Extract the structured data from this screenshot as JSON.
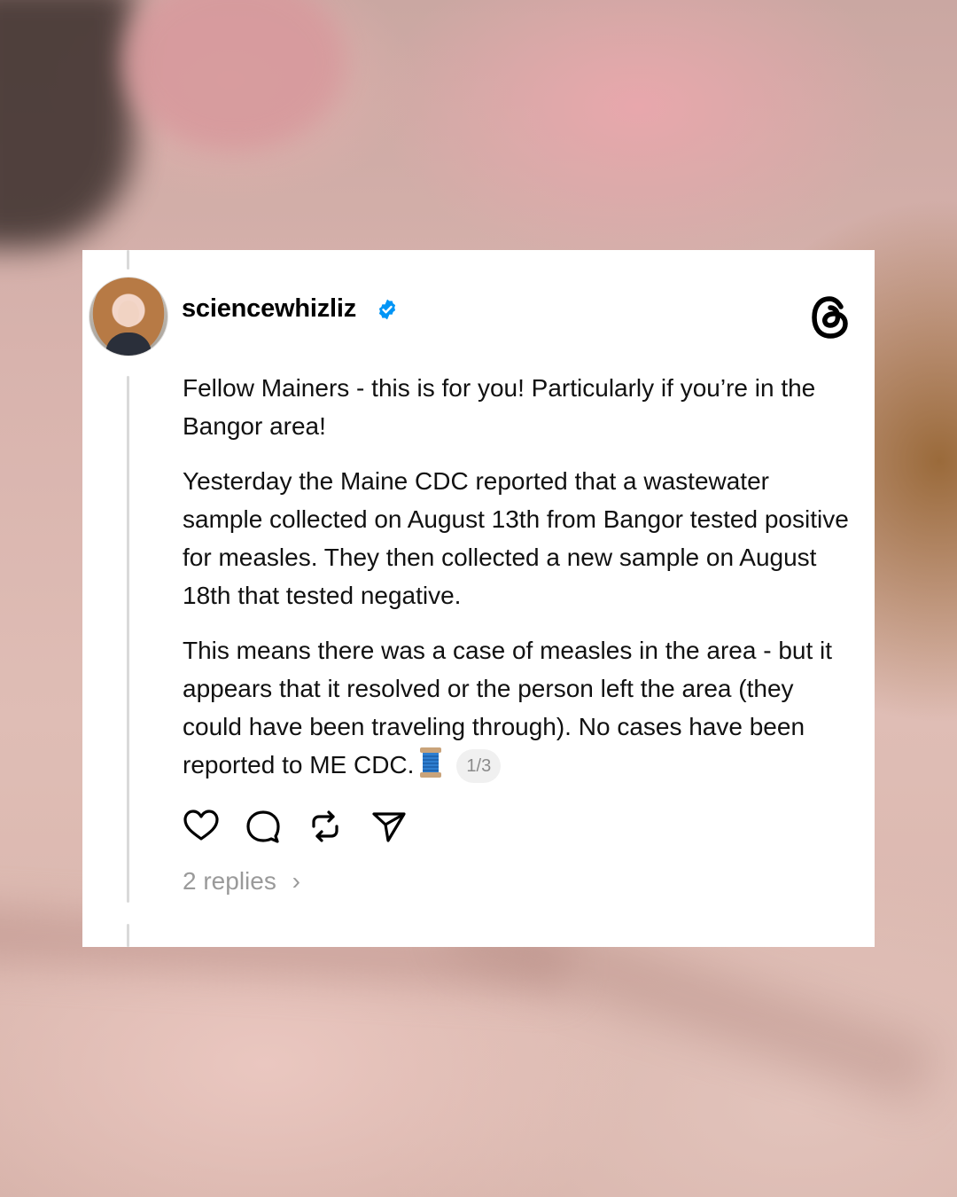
{
  "post": {
    "username": "sciencewhizliz",
    "paragraphs": [
      "Fellow Mainers - this is for you! Particularly if you’re in the Bangor area!",
      "Yesterday the Maine CDC reported that a wastewater sample collected on August 13th from Bangor tested positive for measles. They then collected a new sample on August 18th that tested negative.",
      "This means there was a case of measles in the area - but it appears that it resolved or the person left the area (they could have been traveling through). No cases have been reported to ME CDC."
    ],
    "thread_emoji": "🧵",
    "page_indicator": "1/3",
    "replies_label": "2 replies",
    "replies_chevron": "›"
  },
  "icons": {
    "verified": "verified-badge-icon",
    "logo": "threads-logo-icon",
    "like": "heart-icon",
    "comment": "comment-bubble-icon",
    "repost": "repost-icon",
    "share": "send-icon",
    "thread": "spool-of-thread-icon"
  },
  "colors": {
    "card": "#ffffff",
    "text": "#111111",
    "muted": "#9a9a9a",
    "verified": "#0095f6",
    "thread_line": "#d9d9d9"
  }
}
